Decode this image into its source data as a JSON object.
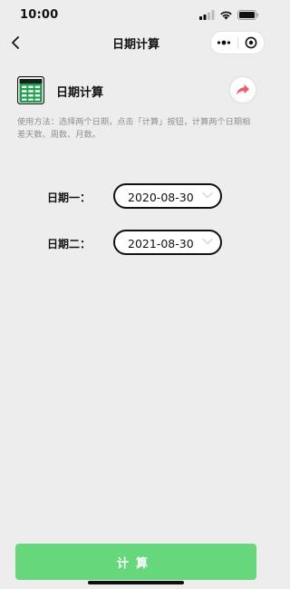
{
  "status_bar": {
    "time": "10:00"
  },
  "nav": {
    "title": "日期计算"
  },
  "header": {
    "title": "日期计算"
  },
  "usage_text": "使用方法：选择两个日期，点击「计算」按钮，计算两个日期相差天数、周数、月数。",
  "dates": [
    {
      "label": "日期一：",
      "value": "2020-08-30"
    },
    {
      "label": "日期二：",
      "value": "2021-08-30"
    }
  ],
  "calc_button": {
    "label": "计算"
  },
  "colors": {
    "accent": "#67d77b",
    "share": "#f05b6b",
    "icon_green": "#1f9a4f"
  },
  "icons": [
    "back-arrow-icon",
    "signal-icon",
    "wifi-icon",
    "battery-icon",
    "more-dots-icon",
    "close-circle-icon",
    "spreadsheet-icon",
    "share-arrow-icon",
    "chevron-down-icon"
  ]
}
